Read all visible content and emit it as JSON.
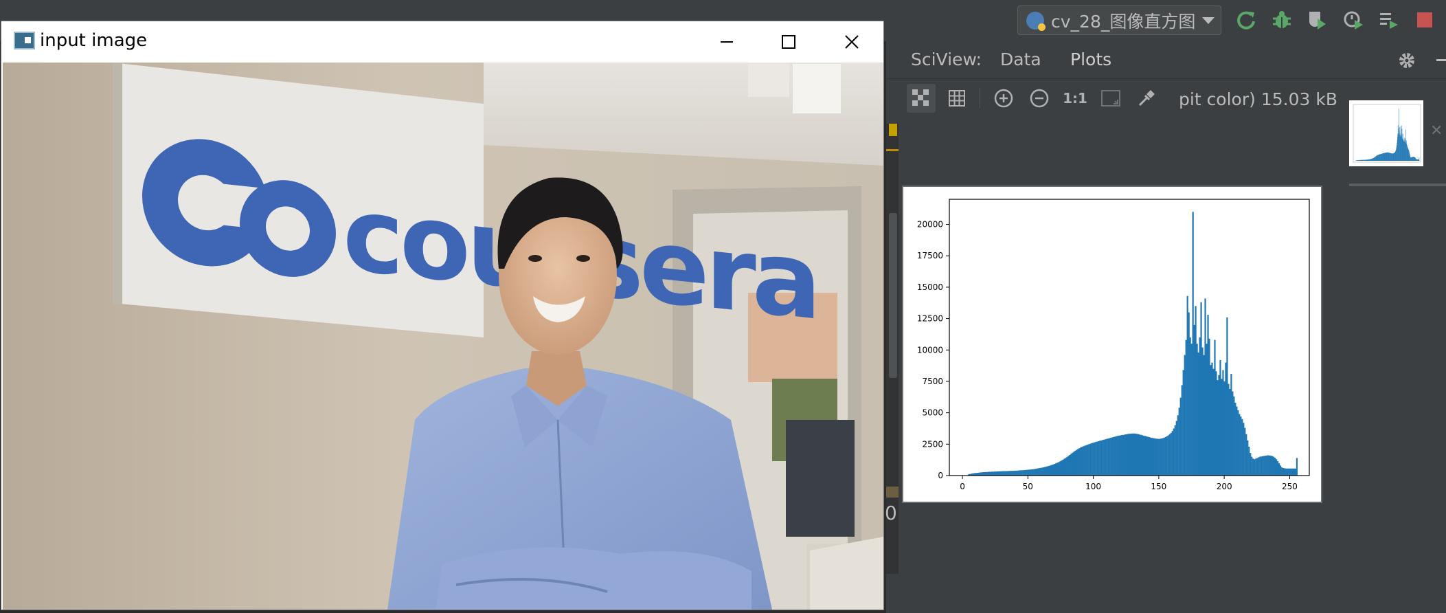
{
  "run_config": {
    "label": "cv_28_图像直方图"
  },
  "toolbar_icons": [
    "rerun-icon",
    "debug-bug-icon",
    "coverage-icon",
    "profile-icon",
    "run-list-icon",
    "stop-icon"
  ],
  "sciview": {
    "title": "SciView:",
    "tabs": [
      {
        "label": "Data",
        "active": false
      },
      {
        "label": "Plots",
        "active": true
      }
    ],
    "toolbar": {
      "one_to_one_label": "1:1"
    },
    "image_info": "pit color) 15.03 kB",
    "left_edge_glyph": "0",
    "colors": {
      "panel": "#3c3f41",
      "bars": "#1f77b4"
    }
  },
  "image_window": {
    "title": "input image",
    "photo_sign_text": "coursera"
  },
  "chart_data": {
    "type": "bar",
    "title": "",
    "xlabel": "",
    "ylabel": "",
    "xlim": [
      -10,
      265
    ],
    "ylim": [
      0,
      22000
    ],
    "xticks": [
      0,
      50,
      100,
      150,
      200,
      250
    ],
    "yticks": [
      0,
      2500,
      5000,
      7500,
      10000,
      12500,
      15000,
      17500,
      20000
    ],
    "bins": 256,
    "x": [
      0,
      256
    ],
    "values": [
      0,
      0,
      0,
      0,
      100,
      120,
      150,
      170,
      190,
      200,
      210,
      220,
      240,
      250,
      260,
      270,
      280,
      280,
      290,
      300,
      300,
      310,
      310,
      320,
      320,
      330,
      330,
      340,
      340,
      350,
      350,
      350,
      360,
      360,
      370,
      370,
      380,
      380,
      390,
      390,
      400,
      410,
      420,
      420,
      430,
      440,
      450,
      460,
      470,
      480,
      490,
      500,
      520,
      540,
      560,
      580,
      600,
      620,
      640,
      660,
      690,
      720,
      750,
      780,
      810,
      850,
      890,
      930,
      980,
      1030,
      1080,
      1140,
      1200,
      1270,
      1340,
      1410,
      1490,
      1570,
      1650,
      1740,
      1820,
      1900,
      1980,
      2050,
      2120,
      2180,
      2240,
      2290,
      2340,
      2380,
      2420,
      2460,
      2500,
      2540,
      2580,
      2610,
      2640,
      2680,
      2710,
      2740,
      2770,
      2800,
      2830,
      2860,
      2890,
      2920,
      2950,
      2980,
      3010,
      3040,
      3070,
      3100,
      3130,
      3160,
      3180,
      3200,
      3220,
      3240,
      3260,
      3280,
      3300,
      3320,
      3330,
      3340,
      3350,
      3350,
      3340,
      3320,
      3300,
      3270,
      3240,
      3210,
      3180,
      3150,
      3120,
      3090,
      3060,
      3030,
      3000,
      2980,
      2960,
      2940,
      2930,
      2920,
      2930,
      2950,
      2980,
      3020,
      3070,
      3130,
      3200,
      3290,
      3400,
      3550,
      3750,
      4000,
      4350,
      4800,
      5400,
      6200,
      7200,
      8400,
      9600,
      10800,
      14300,
      13000,
      11000,
      10500,
      21000,
      12000,
      13500,
      10500,
      9800,
      11000,
      13800,
      10200,
      9600,
      14100,
      10500,
      12800,
      10900,
      8800,
      9000,
      8500,
      10800,
      8300,
      7600,
      8000,
      9200,
      7700,
      8400,
      7500,
      9000,
      12600,
      7300,
      6900,
      8100,
      6700,
      6300,
      5800,
      5500,
      5200,
      4900,
      4700,
      4500,
      4200,
      3800,
      3300,
      2800,
      2300,
      1800,
      1500,
      1350,
      1300,
      1350,
      1400,
      1450,
      1500,
      1520,
      1540,
      1560,
      1580,
      1600,
      1610,
      1600,
      1580,
      1550,
      1500,
      1420,
      1300,
      1150,
      980,
      800,
      650,
      600,
      580,
      560,
      560,
      560,
      560,
      560,
      560,
      560,
      560,
      1400
    ]
  }
}
